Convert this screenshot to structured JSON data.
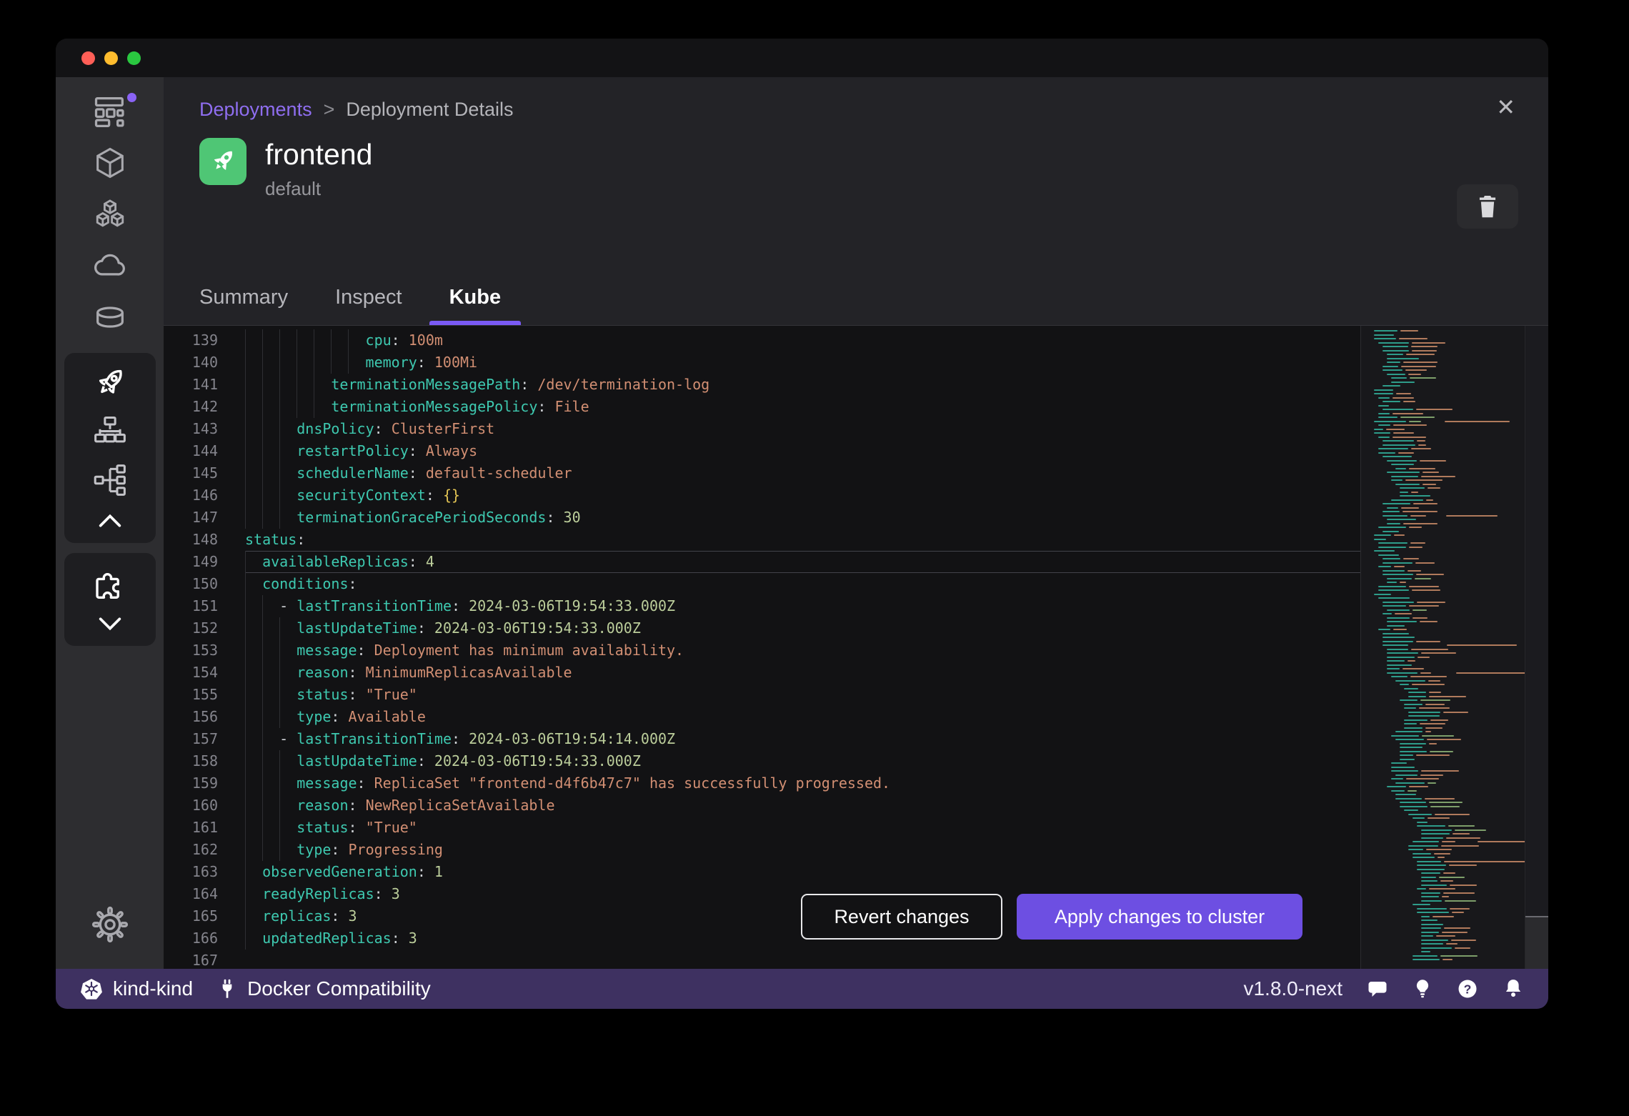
{
  "window": {
    "traffic_lights": [
      "#ff5f57",
      "#febc2e",
      "#2ac840"
    ]
  },
  "sidebar": {
    "items": [
      {
        "id": "containers",
        "icon": "dashboard-icon",
        "notification": true
      },
      {
        "id": "images",
        "icon": "cube-icon"
      },
      {
        "id": "builds",
        "icon": "stacked-cubes-icon"
      },
      {
        "id": "hub",
        "icon": "cloud-icon"
      },
      {
        "id": "volumes",
        "icon": "database-icon"
      },
      {
        "id": "deployments",
        "icon": "rocket-icon",
        "active": true
      },
      {
        "id": "services",
        "icon": "org-chart-icon"
      },
      {
        "id": "pods",
        "icon": "branch-icon"
      },
      {
        "id": "collapse",
        "icon": "chevron-up-icon"
      },
      {
        "id": "extensions",
        "icon": "puzzle-icon"
      },
      {
        "id": "more",
        "icon": "chevron-down-icon"
      },
      {
        "id": "settings",
        "icon": "gear-icon"
      }
    ]
  },
  "breadcrumb": {
    "parent": "Deployments",
    "separator": ">",
    "current": "Deployment Details"
  },
  "header": {
    "title": "frontend",
    "namespace": "default",
    "close_glyph": "✕"
  },
  "tabs": [
    {
      "label": "Summary",
      "active": false
    },
    {
      "label": "Inspect",
      "active": false
    },
    {
      "label": "Kube",
      "active": true
    }
  ],
  "actions": {
    "revert": "Revert changes",
    "apply": "Apply changes to cluster"
  },
  "statusbar": {
    "cluster": "kind-kind",
    "compatibility": "Docker Compatibility",
    "version": "v1.8.0-next"
  },
  "colors": {
    "accent_purple": "#8f6ef0",
    "tab_underline": "#7a5af5",
    "apply_button": "#6d4fe2",
    "statusbar_bg": "#3e3161",
    "app_tile_green": "#4fc675",
    "code_key": "#3ec9b0",
    "code_string": "#d28f73",
    "code_number": "#bcce9b",
    "code_bracket": "#e2c454",
    "minimap_teal": "#2e9c8a",
    "minimap_orange": "#b07a5c"
  },
  "editor": {
    "active_line": 149,
    "lines": [
      {
        "num": 139,
        "indent": 14,
        "tokens": [
          [
            "k",
            "cpu"
          ],
          [
            "p",
            ": "
          ],
          [
            "s",
            "100m"
          ]
        ]
      },
      {
        "num": 140,
        "indent": 14,
        "tokens": [
          [
            "k",
            "memory"
          ],
          [
            "p",
            ": "
          ],
          [
            "s",
            "100Mi"
          ]
        ]
      },
      {
        "num": 141,
        "indent": 10,
        "tokens": [
          [
            "k",
            "terminationMessagePath"
          ],
          [
            "p",
            ": "
          ],
          [
            "s",
            "/dev/termination-log"
          ]
        ]
      },
      {
        "num": 142,
        "indent": 10,
        "tokens": [
          [
            "k",
            "terminationMessagePolicy"
          ],
          [
            "p",
            ": "
          ],
          [
            "s",
            "File"
          ]
        ]
      },
      {
        "num": 143,
        "indent": 6,
        "tokens": [
          [
            "k",
            "dnsPolicy"
          ],
          [
            "p",
            ": "
          ],
          [
            "s",
            "ClusterFirst"
          ]
        ]
      },
      {
        "num": 144,
        "indent": 6,
        "tokens": [
          [
            "k",
            "restartPolicy"
          ],
          [
            "p",
            ": "
          ],
          [
            "s",
            "Always"
          ]
        ]
      },
      {
        "num": 145,
        "indent": 6,
        "tokens": [
          [
            "k",
            "schedulerName"
          ],
          [
            "p",
            ": "
          ],
          [
            "s",
            "default-scheduler"
          ]
        ]
      },
      {
        "num": 146,
        "indent": 6,
        "tokens": [
          [
            "k",
            "securityContext"
          ],
          [
            "p",
            ": "
          ],
          [
            "b",
            "{}"
          ]
        ]
      },
      {
        "num": 147,
        "indent": 6,
        "tokens": [
          [
            "k",
            "terminationGracePeriodSeconds"
          ],
          [
            "p",
            ": "
          ],
          [
            "n",
            "30"
          ]
        ]
      },
      {
        "num": 148,
        "indent": 0,
        "tokens": [
          [
            "k",
            "status"
          ],
          [
            "p",
            ":"
          ]
        ]
      },
      {
        "num": 149,
        "indent": 2,
        "tokens": [
          [
            "k",
            "availableReplicas"
          ],
          [
            "p",
            ": "
          ],
          [
            "n",
            "4"
          ]
        ]
      },
      {
        "num": 150,
        "indent": 2,
        "tokens": [
          [
            "k",
            "conditions"
          ],
          [
            "p",
            ":"
          ]
        ]
      },
      {
        "num": 151,
        "indent": 4,
        "tokens": [
          [
            "p",
            "- "
          ],
          [
            "k",
            "lastTransitionTime"
          ],
          [
            "p",
            ": "
          ],
          [
            "n",
            "2024-03-06T19:54:33.000Z"
          ]
        ]
      },
      {
        "num": 152,
        "indent": 6,
        "tokens": [
          [
            "k",
            "lastUpdateTime"
          ],
          [
            "p",
            ": "
          ],
          [
            "n",
            "2024-03-06T19:54:33.000Z"
          ]
        ]
      },
      {
        "num": 153,
        "indent": 6,
        "tokens": [
          [
            "k",
            "message"
          ],
          [
            "p",
            ": "
          ],
          [
            "s",
            "Deployment has minimum availability."
          ]
        ]
      },
      {
        "num": 154,
        "indent": 6,
        "tokens": [
          [
            "k",
            "reason"
          ],
          [
            "p",
            ": "
          ],
          [
            "s",
            "MinimumReplicasAvailable"
          ]
        ]
      },
      {
        "num": 155,
        "indent": 6,
        "tokens": [
          [
            "k",
            "status"
          ],
          [
            "p",
            ": "
          ],
          [
            "s",
            "\"True\""
          ]
        ]
      },
      {
        "num": 156,
        "indent": 6,
        "tokens": [
          [
            "k",
            "type"
          ],
          [
            "p",
            ": "
          ],
          [
            "s",
            "Available"
          ]
        ]
      },
      {
        "num": 157,
        "indent": 4,
        "tokens": [
          [
            "p",
            "- "
          ],
          [
            "k",
            "lastTransitionTime"
          ],
          [
            "p",
            ": "
          ],
          [
            "n",
            "2024-03-06T19:54:14.000Z"
          ]
        ]
      },
      {
        "num": 158,
        "indent": 6,
        "tokens": [
          [
            "k",
            "lastUpdateTime"
          ],
          [
            "p",
            ": "
          ],
          [
            "n",
            "2024-03-06T19:54:33.000Z"
          ]
        ]
      },
      {
        "num": 159,
        "indent": 6,
        "tokens": [
          [
            "k",
            "message"
          ],
          [
            "p",
            ": "
          ],
          [
            "s",
            "ReplicaSet \"frontend-d4f6b47c7\" has successfully progressed."
          ]
        ]
      },
      {
        "num": 160,
        "indent": 6,
        "tokens": [
          [
            "k",
            "reason"
          ],
          [
            "p",
            ": "
          ],
          [
            "s",
            "NewReplicaSetAvailable"
          ]
        ]
      },
      {
        "num": 161,
        "indent": 6,
        "tokens": [
          [
            "k",
            "status"
          ],
          [
            "p",
            ": "
          ],
          [
            "s",
            "\"True\""
          ]
        ]
      },
      {
        "num": 162,
        "indent": 6,
        "tokens": [
          [
            "k",
            "type"
          ],
          [
            "p",
            ": "
          ],
          [
            "s",
            "Progressing"
          ]
        ]
      },
      {
        "num": 163,
        "indent": 2,
        "tokens": [
          [
            "k",
            "observedGeneration"
          ],
          [
            "p",
            ": "
          ],
          [
            "n",
            "1"
          ]
        ]
      },
      {
        "num": 164,
        "indent": 2,
        "tokens": [
          [
            "k",
            "readyReplicas"
          ],
          [
            "p",
            ": "
          ],
          [
            "n",
            "3"
          ]
        ]
      },
      {
        "num": 165,
        "indent": 2,
        "tokens": [
          [
            "k",
            "replicas"
          ],
          [
            "p",
            ": "
          ],
          [
            "n",
            "3"
          ]
        ]
      },
      {
        "num": 166,
        "indent": 2,
        "tokens": [
          [
            "k",
            "updatedReplicas"
          ],
          [
            "p",
            ": "
          ],
          [
            "n",
            "3"
          ]
        ]
      },
      {
        "num": 167,
        "indent": 0,
        "tokens": []
      }
    ]
  }
}
